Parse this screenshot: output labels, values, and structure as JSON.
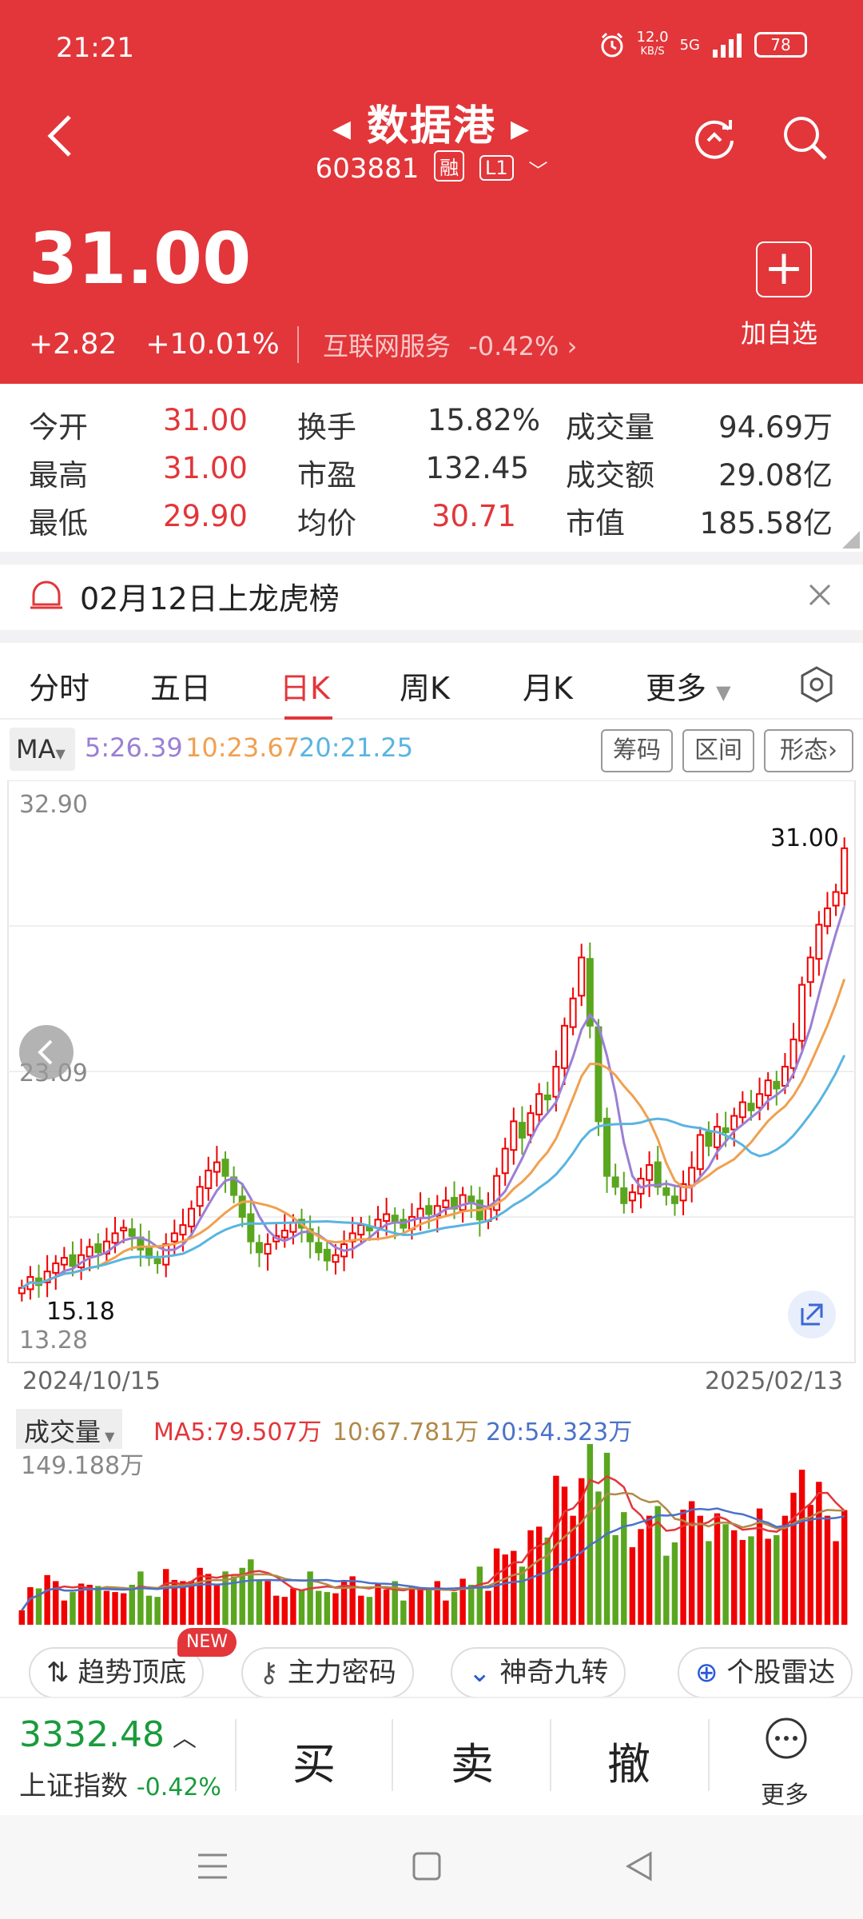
{
  "status": {
    "time": "21:21",
    "net_speed": "12.0",
    "net_unit": "KB/S",
    "net_type": "5G",
    "battery": "78"
  },
  "header": {
    "stock_name": "数据港",
    "stock_code": "603881",
    "tag_margin": "融",
    "tag_level": "L1",
    "price": "31.00",
    "change": "+2.82",
    "change_pct": "+10.01%",
    "sector_name": "互联网服务",
    "sector_pct": "-0.42%",
    "add_label": "加自选"
  },
  "quotes": [
    {
      "label": "今开",
      "value": "31.00"
    },
    {
      "label": "最高",
      "value": "31.00"
    },
    {
      "label": "最低",
      "value": "29.90"
    },
    {
      "label": "换手",
      "value": "15.82%"
    },
    {
      "label": "市盈",
      "value": "132.45"
    },
    {
      "label": "均价",
      "value": "30.71"
    },
    {
      "label": "成交量",
      "value": "94.69万"
    },
    {
      "label": "成交额",
      "value": "29.08亿"
    },
    {
      "label": "市值",
      "value": "185.58亿"
    }
  ],
  "notice": {
    "text": "02月12日上龙虎榜"
  },
  "tabs": [
    "分时",
    "五日",
    "日K",
    "周K",
    "月K",
    "更多"
  ],
  "active_tab": "日K",
  "ma": {
    "button": "MA",
    "ma5": "5:26.39",
    "ma10": "10:23.67",
    "ma20": "20:21.25"
  },
  "chart_buttons": [
    "筹码",
    "区间",
    "形态"
  ],
  "chart_labels": {
    "top_price": "32.90",
    "mid_price": "23.09",
    "bottom_price": "13.28",
    "high_marker": "31.00",
    "low_marker": "15.18",
    "start_date": "2024/10/15",
    "end_date": "2025/02/13"
  },
  "volume": {
    "button": "成交量",
    "ma5": "MA5:79.507万",
    "ma10": "10:67.781万",
    "ma20": "20:54.323万",
    "max_label": "149.188万"
  },
  "tools": [
    "趋势顶底",
    "主力密码",
    "神奇九转",
    "个股雷达"
  ],
  "tools_badge": "NEW",
  "index": {
    "value": "3332.48",
    "name": "上证指数",
    "pct": "-0.42%"
  },
  "actions": {
    "buy": "买",
    "sell": "卖",
    "cancel": "撤",
    "more": "更多"
  },
  "colors": {
    "accent": "#e2363a",
    "up": "#f00000",
    "down": "#5aa61f",
    "ma5": "#9b7fd4",
    "ma10": "#f0a050",
    "ma20": "#5ab4e0"
  },
  "chart_data": {
    "type": "candlestick",
    "y_range": [
      13.28,
      32.9
    ],
    "closes": [
      14.9,
      15.3,
      15.0,
      15.5,
      15.8,
      16.0,
      15.7,
      16.1,
      16.4,
      16.2,
      16.6,
      16.9,
      17.1,
      16.8,
      16.3,
      16.0,
      15.8,
      16.5,
      16.9,
      17.2,
      17.8,
      18.6,
      19.2,
      19.5,
      19.0,
      18.3,
      17.5,
      16.6,
      16.2,
      16.5,
      16.8,
      17.0,
      17.3,
      17.1,
      16.6,
      16.2,
      15.9,
      16.1,
      16.5,
      16.9,
      17.2,
      17.0,
      17.4,
      17.6,
      17.3,
      17.1,
      17.5,
      17.8,
      17.6,
      17.9,
      18.1,
      17.8,
      18.3,
      18.0,
      17.4,
      17.8,
      19.0,
      20.0,
      21.0,
      20.4,
      21.3,
      22.0,
      21.8,
      23.0,
      24.5,
      25.5,
      27.0,
      24.5,
      21.0,
      19.0,
      18.6,
      18.0,
      18.4,
      18.9,
      19.4,
      18.6,
      18.3,
      18.0,
      18.7,
      19.3,
      20.5,
      20.1,
      20.8,
      20.6,
      21.2,
      21.7,
      21.4,
      22.0,
      22.5,
      22.2,
      23.0,
      24.0,
      26.0,
      27.0,
      28.2,
      28.8,
      29.4,
      31.0
    ],
    "ma5_end": 26.39,
    "ma10_end": 23.67,
    "ma20_end": 21.25,
    "volume_max": 149.188,
    "volume_ma5": 79.507,
    "volume_ma10": 67.781,
    "volume_ma20": 54.323
  }
}
